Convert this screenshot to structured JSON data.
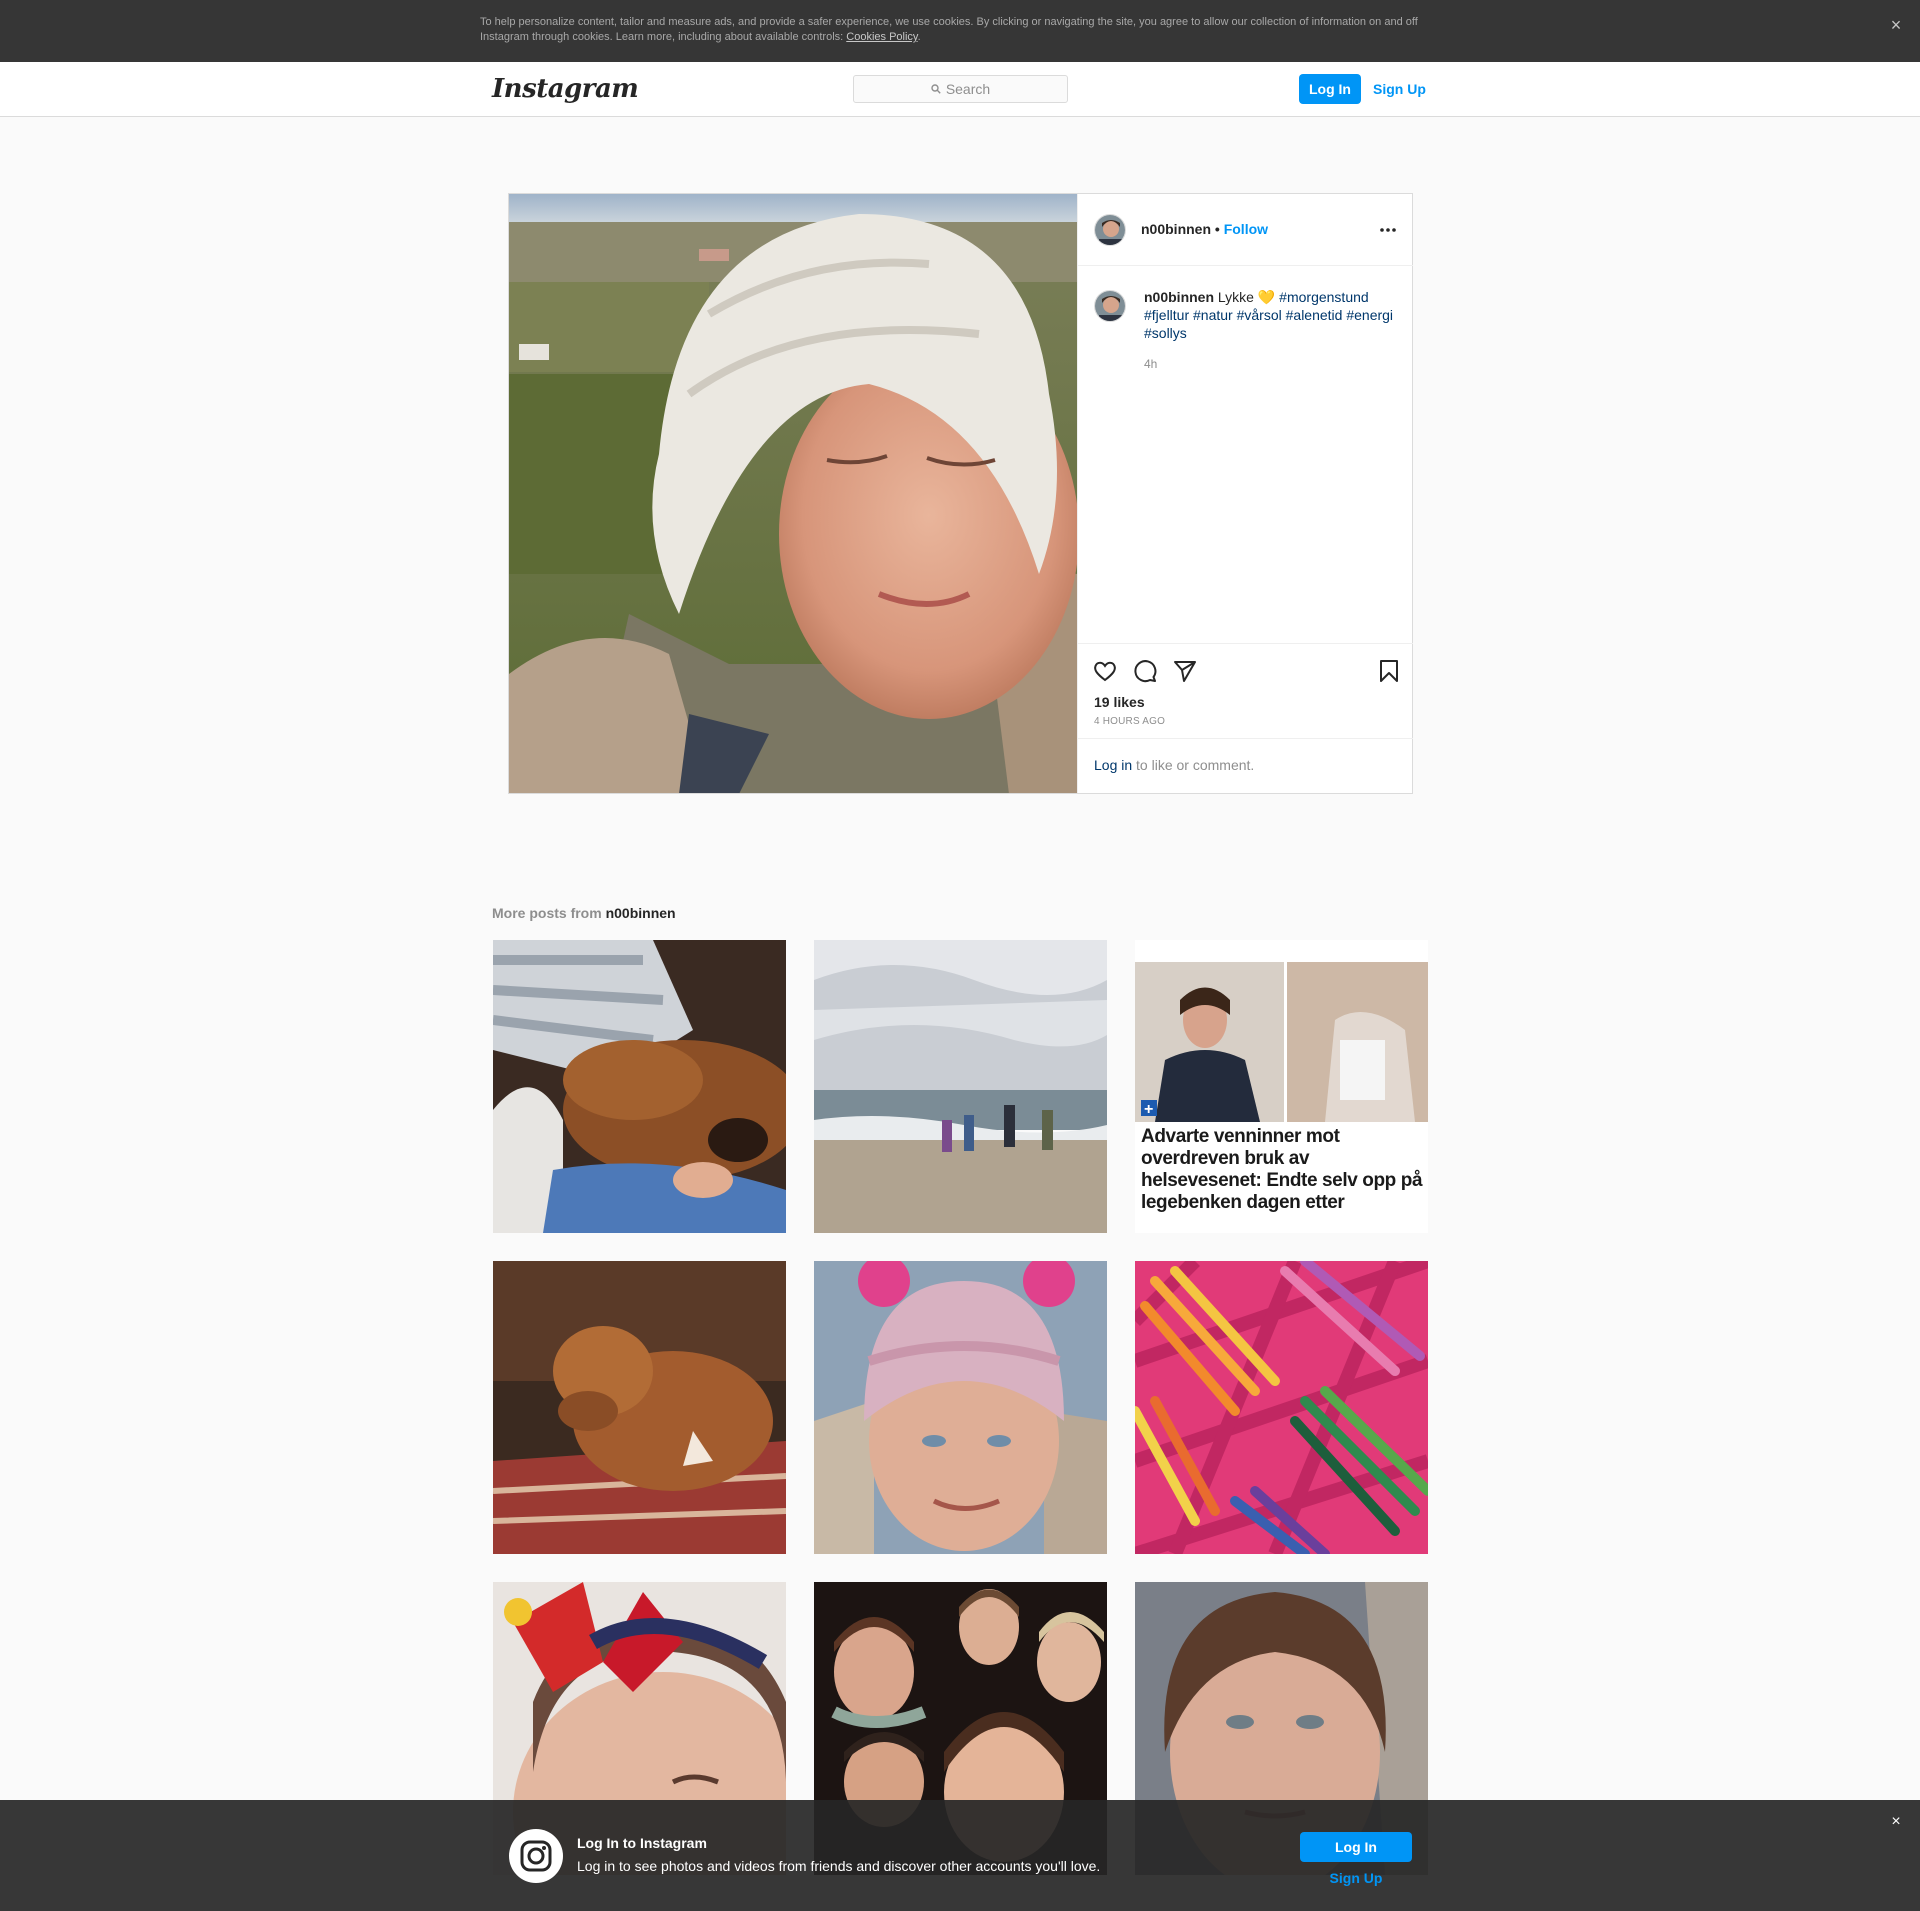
{
  "cookie_banner": {
    "text": "To help personalize content, tailor and measure ads, and provide a safer experience, we use cookies. By clicking or navigating the site, you agree to allow our collection of information on and off Instagram through cookies. Learn more, including about available controls: ",
    "link": "Cookies Policy",
    "period": ".",
    "close": "×"
  },
  "navbar": {
    "logo": "Instagram",
    "search_placeholder": "Search",
    "login": "Log In",
    "signup": "Sign Up"
  },
  "post": {
    "username": "n00binnen",
    "separator": "•",
    "follow": "Follow",
    "caption_text": " Lykke 💛 ",
    "hashtags": "#morgenstund #fjelltur #natur #vårsol #alenetid #energi #sollys",
    "caption_time": "4h",
    "likes": "19 likes",
    "time_ago": "4 HOURS AGO",
    "login_link": "Log in",
    "login_suffix": " to like or comment."
  },
  "more_posts": {
    "prefix": "More posts from ",
    "username": "n00binnen",
    "headline_tile": "Advarte venninner mot overdreven bruk av helsevesenet: Endte selv opp på legebenken dagen etter"
  },
  "login_bar": {
    "title": "Log In to Instagram",
    "subtitle": "Log in to see photos and videos from friends and discover other accounts you'll love.",
    "login": "Log In",
    "signup": "Sign Up",
    "close": "×"
  },
  "colors": {
    "accent": "#0095f6",
    "hashtag": "#00376b",
    "banner_bg": "#363636"
  },
  "icons": [
    "search-icon",
    "more-options-icon",
    "heart-icon",
    "comment-icon",
    "share-icon",
    "bookmark-icon",
    "instagram-logo-icon",
    "close-icon"
  ]
}
